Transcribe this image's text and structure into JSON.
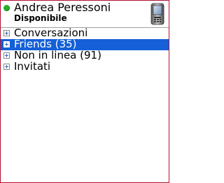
{
  "header": {
    "user_name": "Andrea Peressoni",
    "status": "Disponibile",
    "status_icon": "online-dot-icon",
    "device_icon": "mobile-phone-icon"
  },
  "groups": [
    {
      "label": "Conversazioni",
      "selected": false,
      "icon": "expand-icon"
    },
    {
      "label": "Friends (35)",
      "selected": true,
      "icon": "expand-icon"
    },
    {
      "label": "Non in linea (91)",
      "selected": false,
      "icon": "expand-icon"
    },
    {
      "label": "Invitati",
      "selected": false,
      "icon": "expand-icon"
    }
  ],
  "colors": {
    "online": "#25b025",
    "selection": "#1560d8",
    "frame_border": "#b01030"
  }
}
